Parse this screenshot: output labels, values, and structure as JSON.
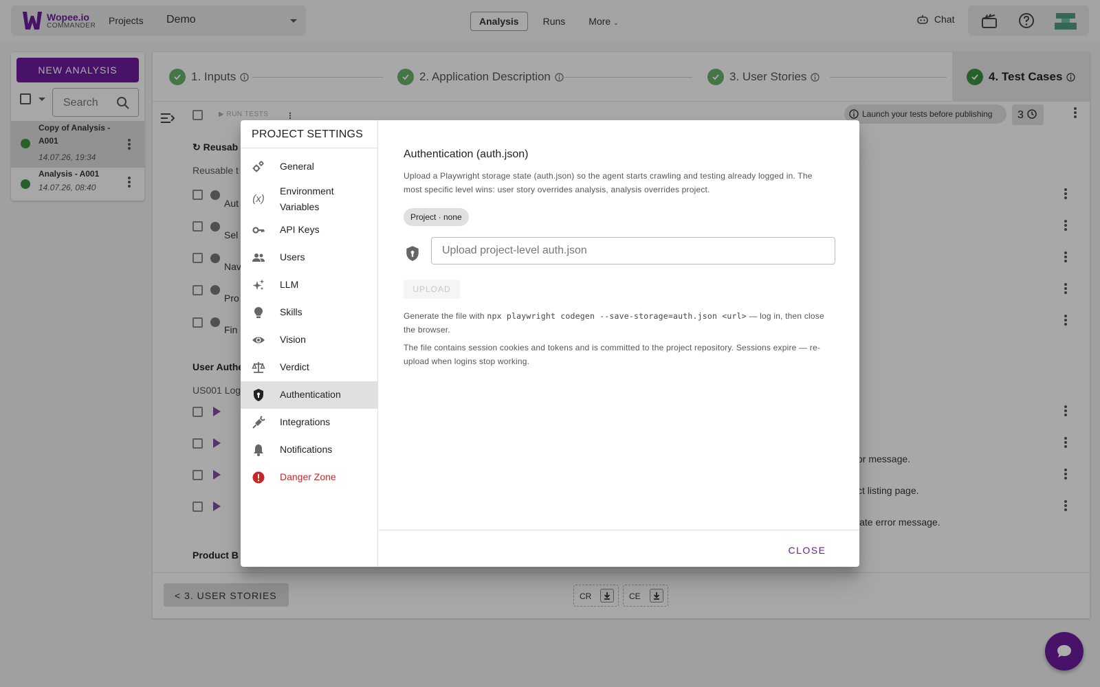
{
  "app": {
    "logo_name": "Wopee.io",
    "logo_sub": "COMMANDER",
    "projects_label": "Projects",
    "project_selected": "Demo"
  },
  "topnav": {
    "tabs": [
      {
        "label": "Analysis",
        "active": true
      },
      {
        "label": "Runs",
        "active": false
      },
      {
        "label": "More",
        "active": false
      }
    ],
    "chat_label": "Chat"
  },
  "left_panel": {
    "new_analysis_label": "NEW ANALYSIS",
    "search_placeholder": "Search",
    "analyses": [
      {
        "name": "Copy of Analysis - A001",
        "date": "14.07.26, 19:34",
        "selected": true
      },
      {
        "name": "Analysis - A001",
        "date": "14.07.26, 08:40",
        "selected": false
      }
    ]
  },
  "stepper": {
    "steps": [
      {
        "label": "1. Inputs",
        "done": true
      },
      {
        "label": "2. Application Description",
        "done": true
      },
      {
        "label": "3. User Stories",
        "done": true
      },
      {
        "label": "4. Test Cases",
        "done": true,
        "current": true
      }
    ]
  },
  "main": {
    "run_tests_label": "RUN TESTS",
    "launch_hint": "Launch your tests before publishing",
    "count": "3",
    "section1_title": "Reusab",
    "section1_sub": "Reusable t",
    "reusable_rows": [
      "Aut",
      "Sel",
      "Nav",
      "Pro",
      "Fin"
    ],
    "section2_title": "User Authe",
    "section2_sub": "US001 Log",
    "bg_row_texts": [
      "or message.",
      "ct listing page.",
      "iate error message."
    ],
    "section3_title": "Product B",
    "back_label": "< 3. USER STORIES",
    "download_chips": [
      "CR",
      "CE"
    ]
  },
  "dialog": {
    "nav_title": "PROJECT SETTINGS",
    "nav_items": [
      {
        "label": "General",
        "icon": "gears-icon"
      },
      {
        "label": "Environment Variables",
        "icon": "variable-icon"
      },
      {
        "label": "API Keys",
        "icon": "key-icon"
      },
      {
        "label": "Users",
        "icon": "users-icon"
      },
      {
        "label": "LLM",
        "icon": "sparkle-icon"
      },
      {
        "label": "Skills",
        "icon": "lightbulb-icon"
      },
      {
        "label": "Vision",
        "icon": "eye-icon"
      },
      {
        "label": "Verdict",
        "icon": "scale-icon"
      },
      {
        "label": "Authentication",
        "icon": "shield-icon",
        "active": true
      },
      {
        "label": "Integrations",
        "icon": "plug-icon"
      },
      {
        "label": "Notifications",
        "icon": "bell-icon"
      },
      {
        "label": "Danger Zone",
        "icon": "alert-icon",
        "danger": true
      }
    ],
    "title": "Authentication (auth.json)",
    "description": "Upload a Playwright storage state (auth.json) so the agent starts crawling and testing already logged in. The most specific level wins: user story overrides analysis, analysis overrides project.",
    "chip": "Project · none",
    "upload_placeholder": "Upload project-level auth.json",
    "upload_label": "UPLOAD",
    "help1_pre": "Generate the file with ",
    "help1_code": "npx playwright codegen --save-storage=auth.json <url>",
    "help1_post": " — log in, then close the browser.",
    "help2": "The file contains session cookies and tokens and is committed to the project repository. Sessions expire — re-upload when logins stop working.",
    "close_label": "CLOSE"
  },
  "colors": {
    "brand": "#6a1b9a",
    "success": "#67ad6a",
    "danger": "#c62828"
  }
}
